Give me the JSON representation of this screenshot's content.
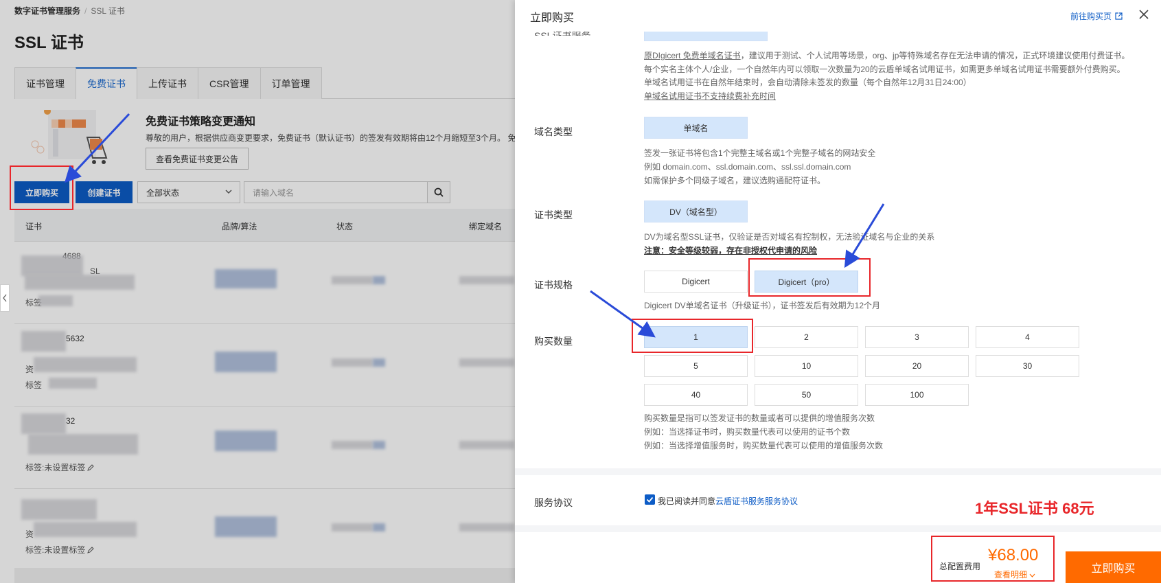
{
  "background": {
    "breadcrumb": [
      "数字证书管理服务",
      "/",
      "SSL 证书"
    ],
    "title": "SSL 证书",
    "tabs": [
      "证书管理",
      "免费证书",
      "上传证书",
      "CSR管理",
      "订单管理"
    ],
    "active_tab_index": 1,
    "notice": {
      "title": "免费证书策略变更通知",
      "text": "尊敬的用户，根据供应商变更要求，免费证书（默认证书）的签发有效期将由12个月缩短至3个月。 免",
      "button": "查看免费证书变更公告"
    },
    "buy_button": "立即购买",
    "create_button": "创建证书",
    "status_select": "全部状态",
    "search_placeholder": "请输入域名",
    "columns": [
      "证书",
      "品牌/算法",
      "状态",
      "绑定域名"
    ],
    "rows": [
      {
        "id": "4688",
        "sub": "SL",
        "tag": "标签"
      },
      {
        "id": "5632",
        "sub": "资",
        "tag": "标签"
      },
      {
        "id": "32",
        "sub": "",
        "tag": "标签:未设置标签"
      },
      {
        "id": "",
        "sub": "资",
        "tag": "标签:未设置标签"
      }
    ]
  },
  "drawer": {
    "title": "立即购买",
    "external_link": "前往购买页",
    "cut_off_label": "SSL证书服务",
    "intro_lines": [
      {
        "link": "原DIgicert 免费单域名证书",
        "text": "，建议用于测试、个人试用等场景，org、jp等特殊域名存在无法申请的情况，正式环境建议使用付费证书。"
      },
      {
        "link": "",
        "text": "每个实名主体个人/企业，一个自然年内可以领取一次数量为20的云盾单域名试用证书，如需更多单域名试用证书需要额外付费购买。"
      },
      {
        "link": "",
        "text": "单域名试用证书在自然年结束时，会自动清除未签发的数量（每个自然年12月31日24:00）"
      },
      {
        "link": "单域名试用证书不支持续费补充时间",
        "text": ""
      }
    ],
    "domain_type": {
      "label": "域名类型",
      "value": "单域名",
      "hints": [
        "签发一张证书将包含1个完整主域名或1个完整子域名的网站安全",
        "例如 domain.com、ssl.domain.com、ssl.ssl.domain.com",
        "如需保护多个同级子域名，建议选购通配符证书。"
      ]
    },
    "cert_type": {
      "label": "证书类型",
      "value": "DV（域名型）",
      "hints": [
        "DV为域名型SSL证书，仅验证是否对域名有控制权，无法验证域名与企业的关系"
      ],
      "warning": "注意：安全等级较弱，存在非授权代申请的风险"
    },
    "spec": {
      "label": "证书规格",
      "options": [
        "Digicert",
        "Digicert（pro）"
      ],
      "selected": 1,
      "hint": "Digicert DV单域名证书（升级证书），证书签发后有效期为12个月"
    },
    "quantity": {
      "label": "购买数量",
      "options": [
        "1",
        "2",
        "3",
        "4",
        "5",
        "10",
        "20",
        "30",
        "40",
        "50",
        "100"
      ],
      "selected": 0,
      "hints": [
        "购买数量是指可以签发证书的数量或者可以提供的增值服务次数",
        "例如：当选择证书时，购买数量代表可以使用的证书个数",
        "例如：当选择增值服务时，购买数量代表可以使用的增值服务次数"
      ]
    },
    "agreement": {
      "label": "服务协议",
      "checked": true,
      "text": "我已阅读并同意",
      "link": "云盾证书服务服务协议"
    },
    "footer": {
      "total_label": "总配置费用",
      "price": "¥68.00",
      "detail_link": "查看明细",
      "buy_button": "立即购买"
    }
  },
  "annotation": {
    "text": "1年SSL证书 68元",
    "color": "#e8262a"
  },
  "colors": {
    "primary": "#0d5cc6",
    "accent": "#ff6a00",
    "selected_bg": "#d4e6fb"
  }
}
